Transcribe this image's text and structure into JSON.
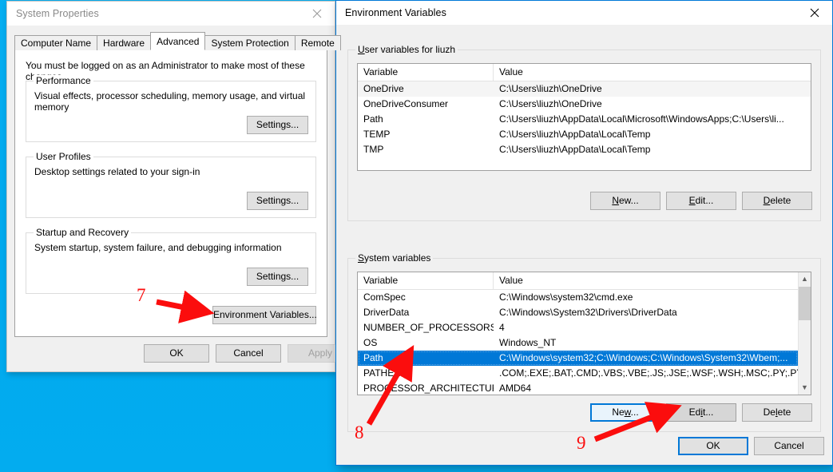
{
  "desktop": {
    "background_color": "#03ADF0"
  },
  "system_properties": {
    "title": "System Properties",
    "close_icon": "close-icon",
    "tabs": [
      {
        "label": "Computer Name",
        "active": false
      },
      {
        "label": "Hardware",
        "active": false
      },
      {
        "label": "Advanced",
        "active": true
      },
      {
        "label": "System Protection",
        "active": false
      },
      {
        "label": "Remote",
        "active": false
      }
    ],
    "admin_note": "You must be logged on as an Administrator to make most of these changes.",
    "groups": [
      {
        "title": "Performance",
        "description": "Visual effects, processor scheduling, memory usage, and virtual memory",
        "button": "Settings..."
      },
      {
        "title": "User Profiles",
        "description": "Desktop settings related to your sign-in",
        "button": "Settings..."
      },
      {
        "title": "Startup and Recovery",
        "description": "System startup, system failure, and debugging information",
        "button": "Settings..."
      }
    ],
    "environment_variables_button": "Environment Variables...",
    "footer_buttons": [
      {
        "label": "OK",
        "disabled": false
      },
      {
        "label": "Cancel",
        "disabled": false
      },
      {
        "label": "Apply",
        "disabled": true
      }
    ]
  },
  "environment_variables": {
    "title": "Environment Variables",
    "close_icon": "close-icon",
    "user_section": {
      "legend_accel": "U",
      "legend_rest": "ser variables for liuzh",
      "columns": [
        "Variable",
        "Value"
      ],
      "rows": [
        {
          "variable": "OneDrive",
          "value": "C:\\Users\\liuzh\\OneDrive",
          "selected": false
        },
        {
          "variable": "OneDriveConsumer",
          "value": "C:\\Users\\liuzh\\OneDrive",
          "selected": false
        },
        {
          "variable": "Path",
          "value": "C:\\Users\\liuzh\\AppData\\Local\\Microsoft\\WindowsApps;C:\\Users\\li...",
          "selected": false
        },
        {
          "variable": "TEMP",
          "value": "C:\\Users\\liuzh\\AppData\\Local\\Temp",
          "selected": false
        },
        {
          "variable": "TMP",
          "value": "C:\\Users\\liuzh\\AppData\\Local\\Temp",
          "selected": false
        }
      ],
      "buttons": [
        {
          "accel": "N",
          "rest": "ew...",
          "state": "normal"
        },
        {
          "accel": "E",
          "rest": "dit...",
          "state": "normal"
        },
        {
          "accel": "D",
          "rest": "elete",
          "state": "normal"
        }
      ]
    },
    "system_section": {
      "legend_accel": "S",
      "legend_rest": "ystem variables",
      "columns": [
        "Variable",
        "Value"
      ],
      "rows": [
        {
          "variable": "ComSpec",
          "value": "C:\\Windows\\system32\\cmd.exe",
          "selected": false
        },
        {
          "variable": "DriverData",
          "value": "C:\\Windows\\System32\\Drivers\\DriverData",
          "selected": false
        },
        {
          "variable": "NUMBER_OF_PROCESSORS",
          "value": "4",
          "selected": false
        },
        {
          "variable": "OS",
          "value": "Windows_NT",
          "selected": false
        },
        {
          "variable": "Path",
          "value": "C:\\Windows\\system32;C:\\Windows;C:\\Windows\\System32\\Wbem;...",
          "selected": true
        },
        {
          "variable": "PATHEXT",
          "value": ".COM;.EXE;.BAT;.CMD;.VBS;.VBE;.JS;.JSE;.WSF;.WSH;.MSC;.PY;.PYW",
          "selected": false
        },
        {
          "variable": "PROCESSOR_ARCHITECTURE",
          "value": "AMD64",
          "selected": false
        }
      ],
      "buttons": [
        {
          "pre": "Ne",
          "accel": "w",
          "rest": "...",
          "state": "focus"
        },
        {
          "pre": "Ed",
          "accel": "i",
          "rest": "t...",
          "state": "hover"
        },
        {
          "pre": "De",
          "accel": "l",
          "rest": "ete",
          "state": "normal"
        }
      ]
    },
    "footer_buttons": [
      {
        "label": "OK",
        "state": "default"
      },
      {
        "label": "Cancel",
        "state": "normal"
      }
    ]
  },
  "annotations": {
    "color": "#fb0d0d",
    "items": [
      {
        "number": "7",
        "target": "environment-variables-button"
      },
      {
        "number": "8",
        "target": "system-variables-path-row"
      },
      {
        "number": "9",
        "target": "system-variables-edit-button"
      }
    ]
  }
}
